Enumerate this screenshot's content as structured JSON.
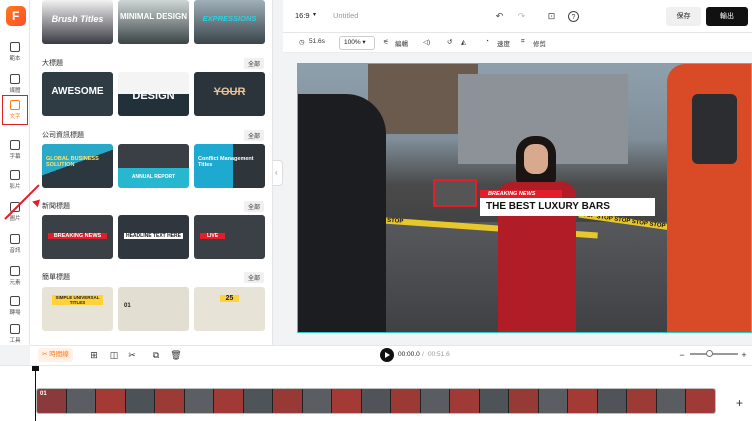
{
  "colors": {
    "accent": "#ff7a1a",
    "highlight": "#e02020",
    "selection": "#37c6c0"
  },
  "rail": {
    "logo_letter": "F",
    "items": [
      {
        "label": "範本",
        "icon": "template-icon"
      },
      {
        "label": "媒體",
        "icon": "upload-icon"
      },
      {
        "label": "文字",
        "icon": "text-icon"
      },
      {
        "label": "字幕",
        "icon": "subtitle-icon"
      },
      {
        "label": "影片",
        "icon": "video-icon"
      },
      {
        "label": "圖片",
        "icon": "image-icon"
      },
      {
        "label": "音訊",
        "icon": "music-icon"
      },
      {
        "label": "元素",
        "icon": "elements-icon"
      },
      {
        "label": "轉場",
        "icon": "transition-icon"
      },
      {
        "label": "工具",
        "icon": "tools-icon"
      }
    ]
  },
  "panel": {
    "top_thumbs": [
      "Brush Titles",
      "MINIMAL DESIGN",
      "EXPRESSIONS"
    ],
    "sections": [
      {
        "title": "大標題",
        "all": "全部",
        "thumbs": [
          "AWESOME",
          "DESIGN",
          "YOUR"
        ]
      },
      {
        "title": "公司資訊標題",
        "all": "全部",
        "thumbs": [
          "GLOBAL BUSINESS SOLUTION",
          "ANNUAL REPORT",
          "Conflict Management Titles"
        ]
      },
      {
        "title": "新聞標題",
        "all": "全部",
        "thumbs": [
          "BREAKING NEWS",
          "HEADLINE TEXT HERE",
          "LIVE"
        ]
      },
      {
        "title": "簡單標題",
        "all": "全部",
        "thumbs": [
          "SIMPLE UNIVERSAL TITLES",
          "01",
          "25"
        ]
      }
    ]
  },
  "header": {
    "aspect": "16:9",
    "project_name": "Untitled",
    "save": "保存",
    "export": "輸出"
  },
  "toolbar": {
    "duration": "51.6s",
    "zoom": "100%",
    "edit": "編輯",
    "speed": "速度",
    "crop": "修剪"
  },
  "canvas": {
    "lower_third_tag": "BREAKING NEWS",
    "lower_third_title": "THE BEST LUXURY BARS",
    "tape_text": "STOP STOP STOP STOP STOP STOP"
  },
  "playbar": {
    "timeline_btn": "時間線",
    "current_time": "00:00.0",
    "total_time": "00:51.6"
  },
  "timeline": {
    "track_number": "01"
  }
}
